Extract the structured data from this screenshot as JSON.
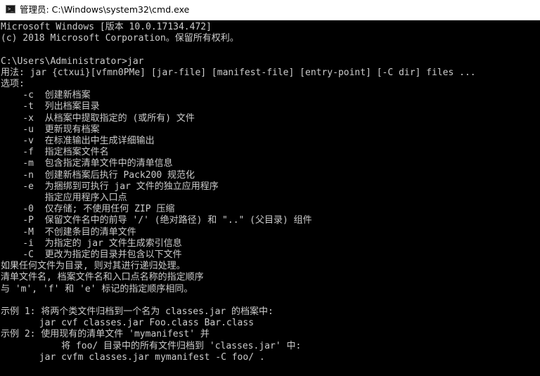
{
  "window": {
    "title": "管理员: C:\\Windows\\system32\\cmd.exe",
    "icon": "cmd-prompt-icon"
  },
  "console": {
    "text_color": "#cccccc",
    "background": "#000000",
    "lines": [
      "Microsoft Windows [版本 10.0.17134.472]",
      "(c) 2018 Microsoft Corporation。保留所有权利。",
      "",
      "C:\\Users\\Administrator>jar",
      "用法: jar {ctxui}[vfmn0PMe] [jar-file] [manifest-file] [entry-point] [-C dir] files ...",
      "选项:",
      "    -c  创建新档案",
      "    -t  列出档案目录",
      "    -x  从档案中提取指定的 (或所有) 文件",
      "    -u  更新现有档案",
      "    -v  在标准输出中生成详细输出",
      "    -f  指定档案文件名",
      "    -m  包含指定清单文件中的清单信息",
      "    -n  创建新档案后执行 Pack200 规范化",
      "    -e  为捆绑到可执行 jar 文件的独立应用程序",
      "        指定应用程序入口点",
      "    -0  仅存储; 不使用任何 ZIP 压缩",
      "    -P  保留文件名中的前导 '/' (绝对路径) 和 \"..\" (父目录) 组件",
      "    -M  不创建条目的清单文件",
      "    -i  为指定的 jar 文件生成索引信息",
      "    -C  更改为指定的目录并包含以下文件",
      "如果任何文件为目录, 则对其进行递归处理。",
      "清单文件名, 档案文件名和入口点名称的指定顺序",
      "与 'm', 'f' 和 'e' 标记的指定顺序相同。",
      "",
      "示例 1: 将两个类文件归档到一个名为 classes.jar 的档案中:",
      "       jar cvf classes.jar Foo.class Bar.class",
      "示例 2: 使用现有的清单文件 'mymanifest' 并",
      "           将 foo/ 目录中的所有文件归档到 'classes.jar' 中:",
      "       jar cvfm classes.jar mymanifest -C foo/ ."
    ]
  }
}
